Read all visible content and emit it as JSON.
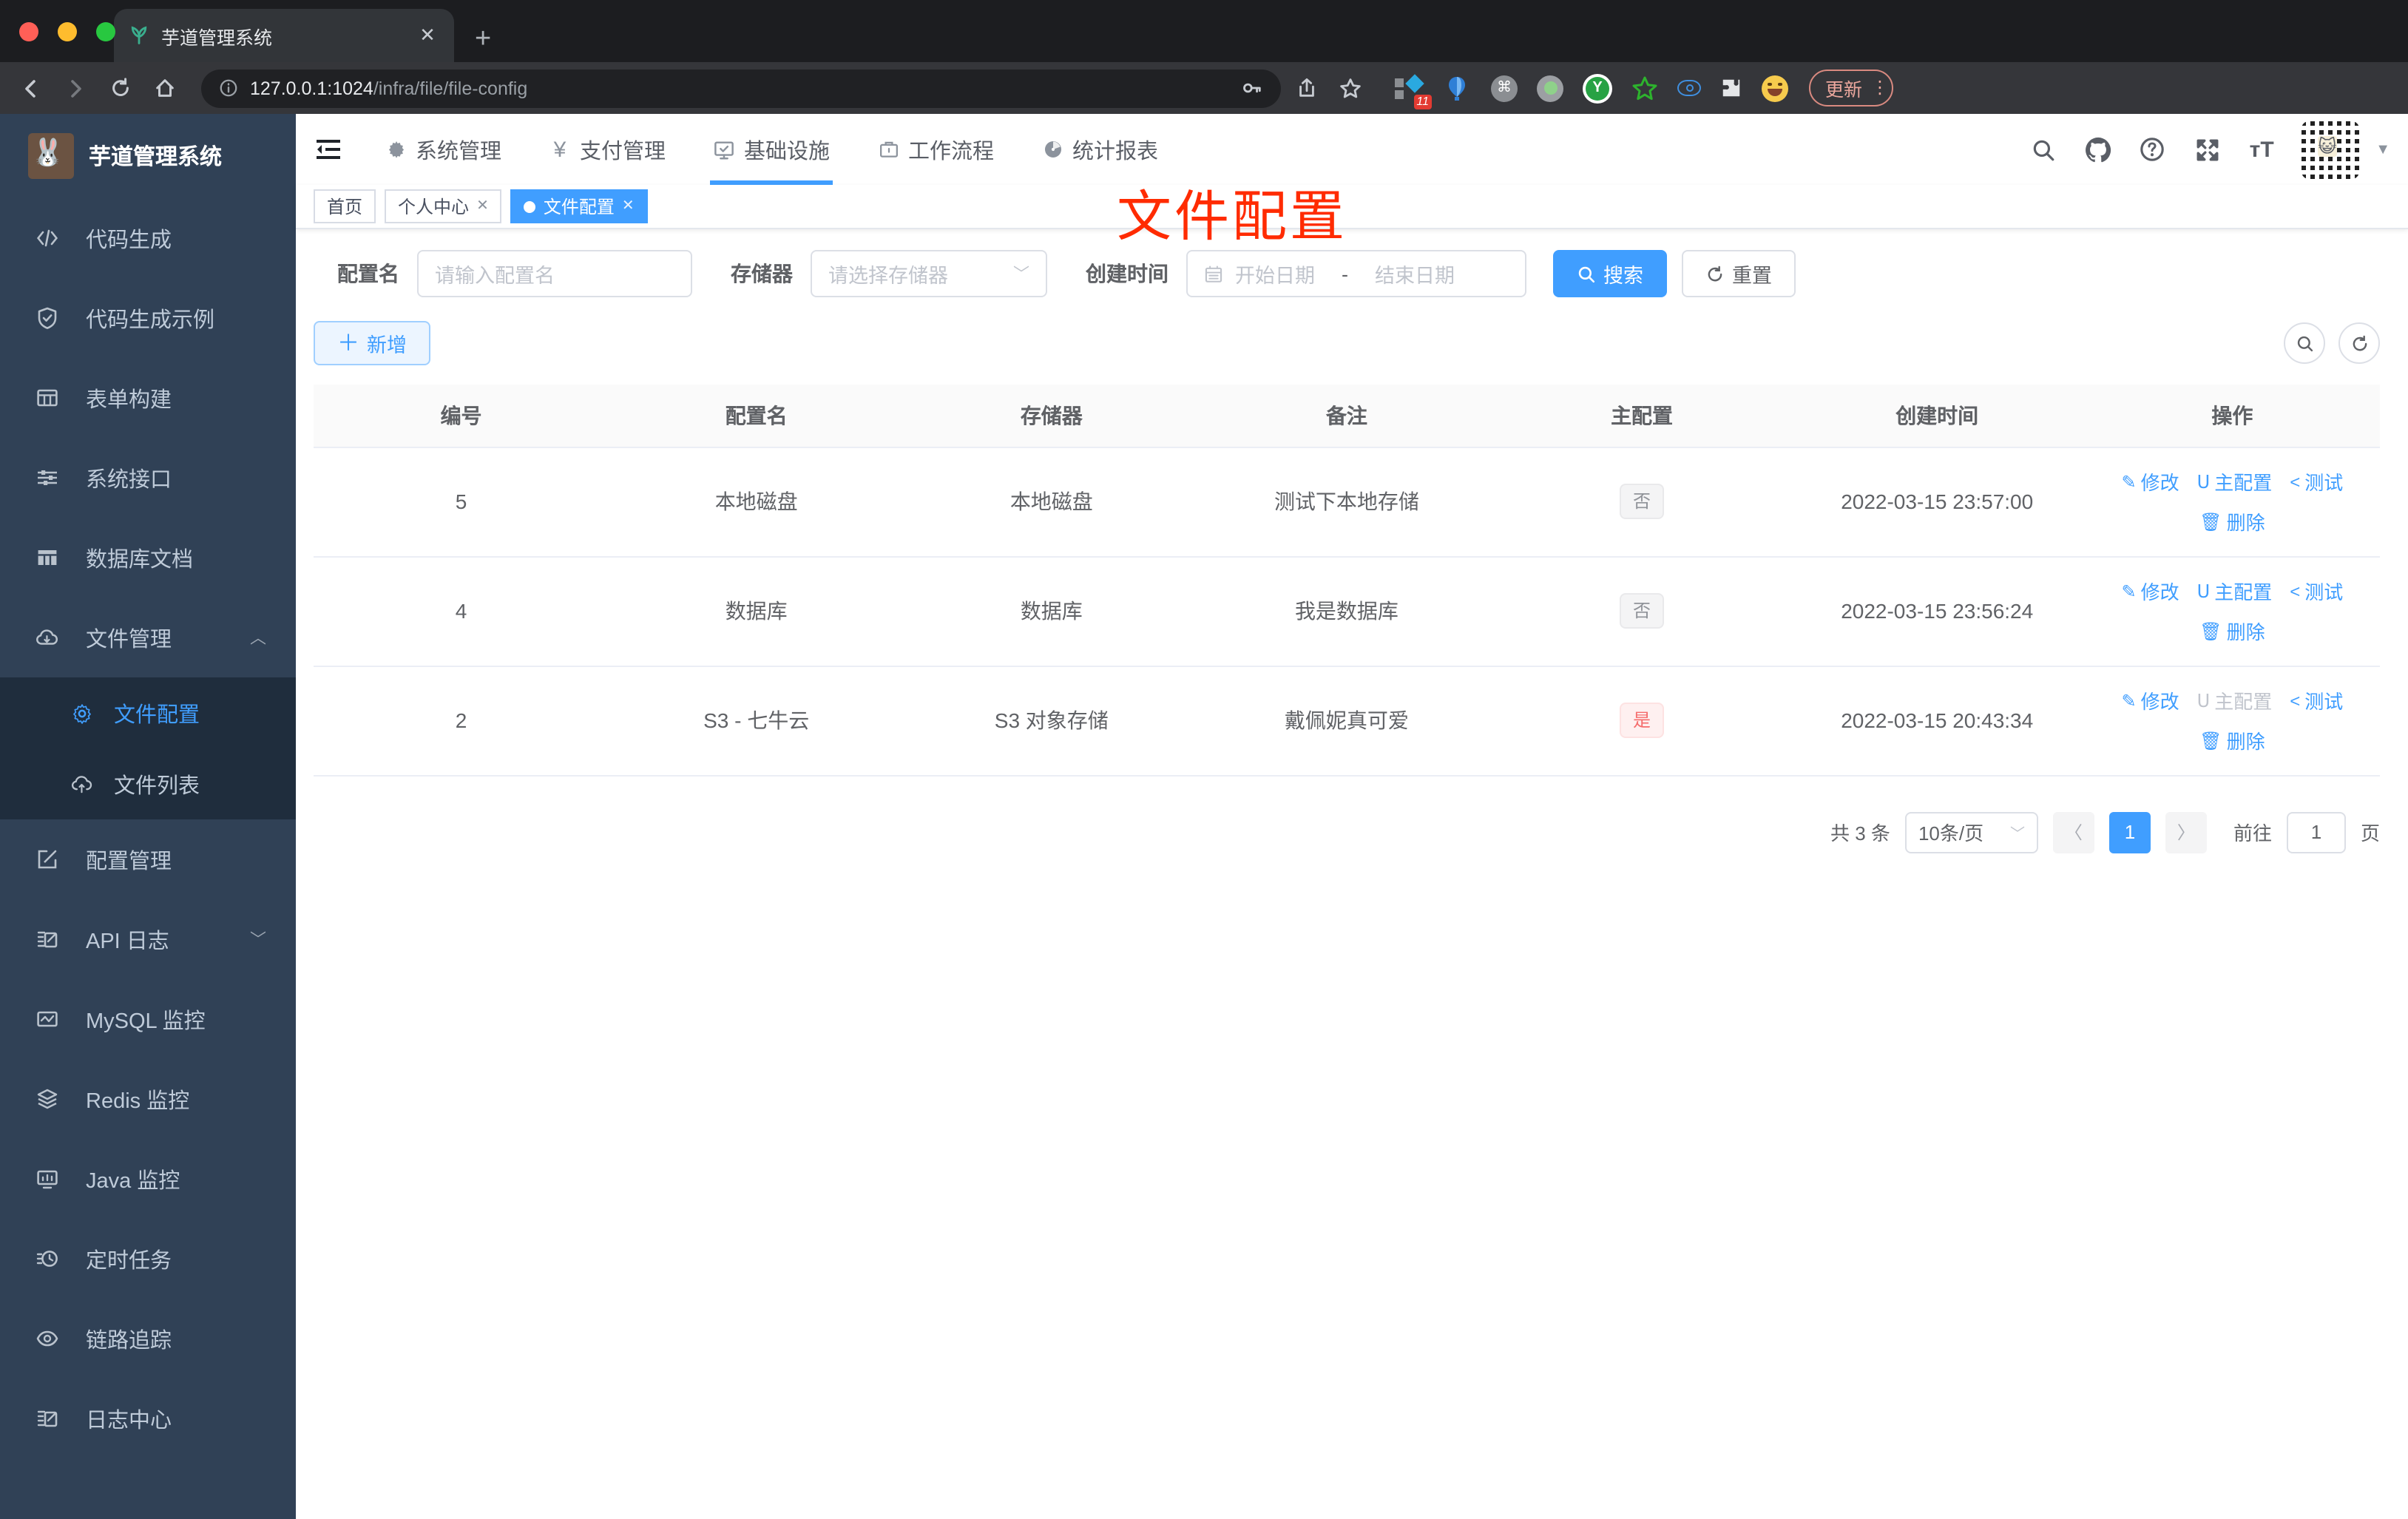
{
  "browser": {
    "tab_title": "芋道管理系统",
    "url_host": "127.0.0.1:1024",
    "url_path": "/infra/file/file-config",
    "update_label": "更新",
    "extension_badge": "11",
    "y_extension_letter": "Y"
  },
  "sidebar": {
    "title": "芋道管理系统",
    "items": [
      {
        "label": "代码生成",
        "icon": "code-icon"
      },
      {
        "label": "代码生成示例",
        "icon": "shield-check-icon"
      },
      {
        "label": "表单构建",
        "icon": "form-grid-icon"
      },
      {
        "label": "系统接口",
        "icon": "sliders-icon"
      },
      {
        "label": "数据库文档",
        "icon": "table-icon"
      },
      {
        "label": "文件管理",
        "icon": "cloud-icon",
        "expanded": true
      },
      {
        "label": "文件配置",
        "icon": "gear-icon",
        "active": true,
        "submenu": true
      },
      {
        "label": "文件列表",
        "icon": "cloud-upload-icon",
        "submenu": true
      },
      {
        "label": "配置管理",
        "icon": "edit-square-icon"
      },
      {
        "label": "API 日志",
        "icon": "log-edit-icon",
        "collapsible": true
      },
      {
        "label": "MySQL 监控",
        "icon": "chart-icon"
      },
      {
        "label": "Redis 监控",
        "icon": "layers-icon"
      },
      {
        "label": "Java 监控",
        "icon": "monitor-icon"
      },
      {
        "label": "定时任务",
        "icon": "timer-icon"
      },
      {
        "label": "链路追踪",
        "icon": "eye-icon"
      },
      {
        "label": "日志中心",
        "icon": "doc-edit-icon"
      }
    ]
  },
  "topnav": {
    "items": [
      {
        "label": "系统管理"
      },
      {
        "label": "支付管理"
      },
      {
        "label": "基础设施",
        "active": true
      },
      {
        "label": "工作流程"
      },
      {
        "label": "统计报表"
      }
    ]
  },
  "tags": {
    "items": [
      {
        "label": "首页"
      },
      {
        "label": "个人中心",
        "closable": true
      },
      {
        "label": "文件配置",
        "closable": true,
        "active": true
      }
    ]
  },
  "overlay": {
    "page_label": "文件配置",
    "color": "#ff2b00"
  },
  "filter": {
    "name_label": "配置名",
    "name_placeholder": "请输入配置名",
    "storage_label": "存储器",
    "storage_placeholder": "请选择存储器",
    "time_label": "创建时间",
    "start_placeholder": "开始日期",
    "separator": "-",
    "end_placeholder": "结束日期",
    "search_label": "搜索",
    "reset_label": "重置"
  },
  "toolbar": {
    "add_label": "新增"
  },
  "table": {
    "headers": [
      "编号",
      "配置名",
      "存储器",
      "备注",
      "主配置",
      "创建时间",
      "操作"
    ],
    "actions": {
      "edit": "修改",
      "master": "主配置",
      "test": "测试",
      "delete": "删除"
    },
    "rows": [
      {
        "id": "5",
        "name": "本地磁盘",
        "storage": "本地磁盘",
        "remark": "测试下本地存储",
        "master": "否",
        "time": "2022-03-15 23:57:00",
        "master_action_enabled": true
      },
      {
        "id": "4",
        "name": "数据库",
        "storage": "数据库",
        "remark": "我是数据库",
        "master": "否",
        "time": "2022-03-15 23:56:24",
        "master_action_enabled": true
      },
      {
        "id": "2",
        "name": "S3 - 七牛云",
        "storage": "S3 对象存储",
        "remark": "戴佩妮真可爱",
        "master": "是",
        "time": "2022-03-15 20:43:34",
        "master_action_enabled": false
      }
    ]
  },
  "pagination": {
    "total": "共 3 条",
    "page_size": "10条/页",
    "page": "1",
    "goto_label": "前往",
    "goto_value": "1",
    "page_unit": "页"
  },
  "colors": {
    "primary": "#409eff",
    "danger": "#f56c6c",
    "sidebar_bg": "#304156",
    "submenu_bg": "#1f2d3d"
  }
}
